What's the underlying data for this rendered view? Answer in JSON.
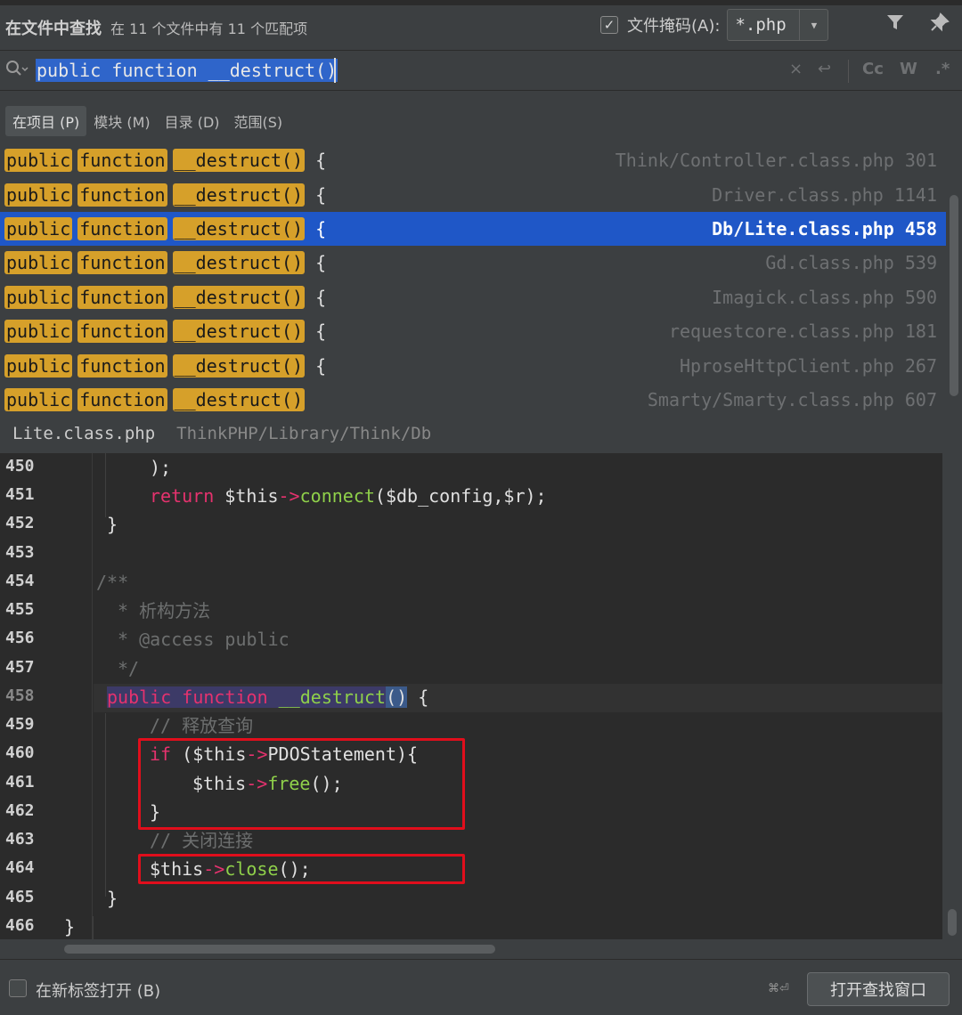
{
  "header": {
    "title": "在文件中查找",
    "summary": "在 11 个文件中有 11 个匹配项",
    "file_mask_label": "文件掩码(A):",
    "file_mask_checked": "✓",
    "file_mask_value": "*.php",
    "filter_icon": "filter-icon",
    "pin_icon": "pin-icon"
  },
  "search": {
    "query": "public function __destruct()",
    "options": {
      "clear": "×",
      "wrap": "↩",
      "case": "Cc",
      "words": "W",
      "regex": ".*"
    }
  },
  "scopes": [
    {
      "label": "在项目 (P)",
      "active": true
    },
    {
      "label": "模块 (M)",
      "active": false
    },
    {
      "label": "目录 (D)",
      "active": false
    },
    {
      "label": "范围(S)",
      "active": false
    }
  ],
  "results": [
    {
      "w1": "public",
      "w2": "function",
      "w3": "__destruct()",
      "brace": "{",
      "file": "Think/Controller.class.php 301"
    },
    {
      "w1": "public",
      "w2": "function",
      "w3": "__destruct()",
      "brace": "{",
      "file": "Driver.class.php 1141"
    },
    {
      "w1": "public",
      "w2": "function",
      "w3": "__destruct()",
      "brace": "{",
      "file": "Db/Lite.class.php 458",
      "selected": true
    },
    {
      "w1": "public",
      "w2": "function",
      "w3": "__destruct()",
      "brace": "{",
      "file": "Gd.class.php 539"
    },
    {
      "w1": "public",
      "w2": "function",
      "w3": "__destruct()",
      "brace": "{",
      "file": "Imagick.class.php 590"
    },
    {
      "w1": "public",
      "w2": "function",
      "w3": "__destruct()",
      "brace": "{",
      "file": "requestcore.class.php 181"
    },
    {
      "w1": "public",
      "w2": "function",
      "w3": "__destruct()",
      "brace": "{",
      "file": "HproseHttpClient.php 267"
    },
    {
      "w1": "public",
      "w2": "function",
      "w3": "__destruct()",
      "brace": "",
      "file": "Smarty/Smarty.class.php 607"
    }
  ],
  "preview": {
    "file": "Lite.class.php",
    "path": "ThinkPHP/Library/Think/Db"
  },
  "code": {
    "lines": [
      "450",
      "451",
      "452",
      "453",
      "454",
      "455",
      "456",
      "457",
      "458",
      "459",
      "460",
      "461",
      "462",
      "463",
      "464",
      "465",
      "466"
    ],
    "l450": ");",
    "l451_return": "return",
    "l451_this": "$this",
    "l451_arrow": "->",
    "l451_fn": "connect",
    "l451_rest": "($db_config,$r);",
    "l452": "}",
    "l454": "/**",
    "l455": "* 析构方法",
    "l456": "* @access public",
    "l457": "*/",
    "l458_public": "public",
    "l458_function": "function",
    "l458_name": "__destruct",
    "l458_parens": "()",
    "l458_brace": "{",
    "l459": "// 释放查询",
    "l460_if": "if",
    "l460_open": "(",
    "l460_this": "$this",
    "l460_arrow": "->",
    "l460_prop": "PDOStatement",
    "l460_close": "){",
    "l461_this": "$this",
    "l461_arrow": "->",
    "l461_fn": "free",
    "l461_rest": "();",
    "l462": "}",
    "l463": "// 关闭连接",
    "l464_this": "$this",
    "l464_arrow": "->",
    "l464_fn": "close",
    "l464_rest": "();",
    "l465": "}",
    "l466": "}"
  },
  "footer": {
    "new_tab_label": "在新标签打开 (B)",
    "shortcut": "⌘⏎",
    "open_button": "打开查找窗口"
  }
}
